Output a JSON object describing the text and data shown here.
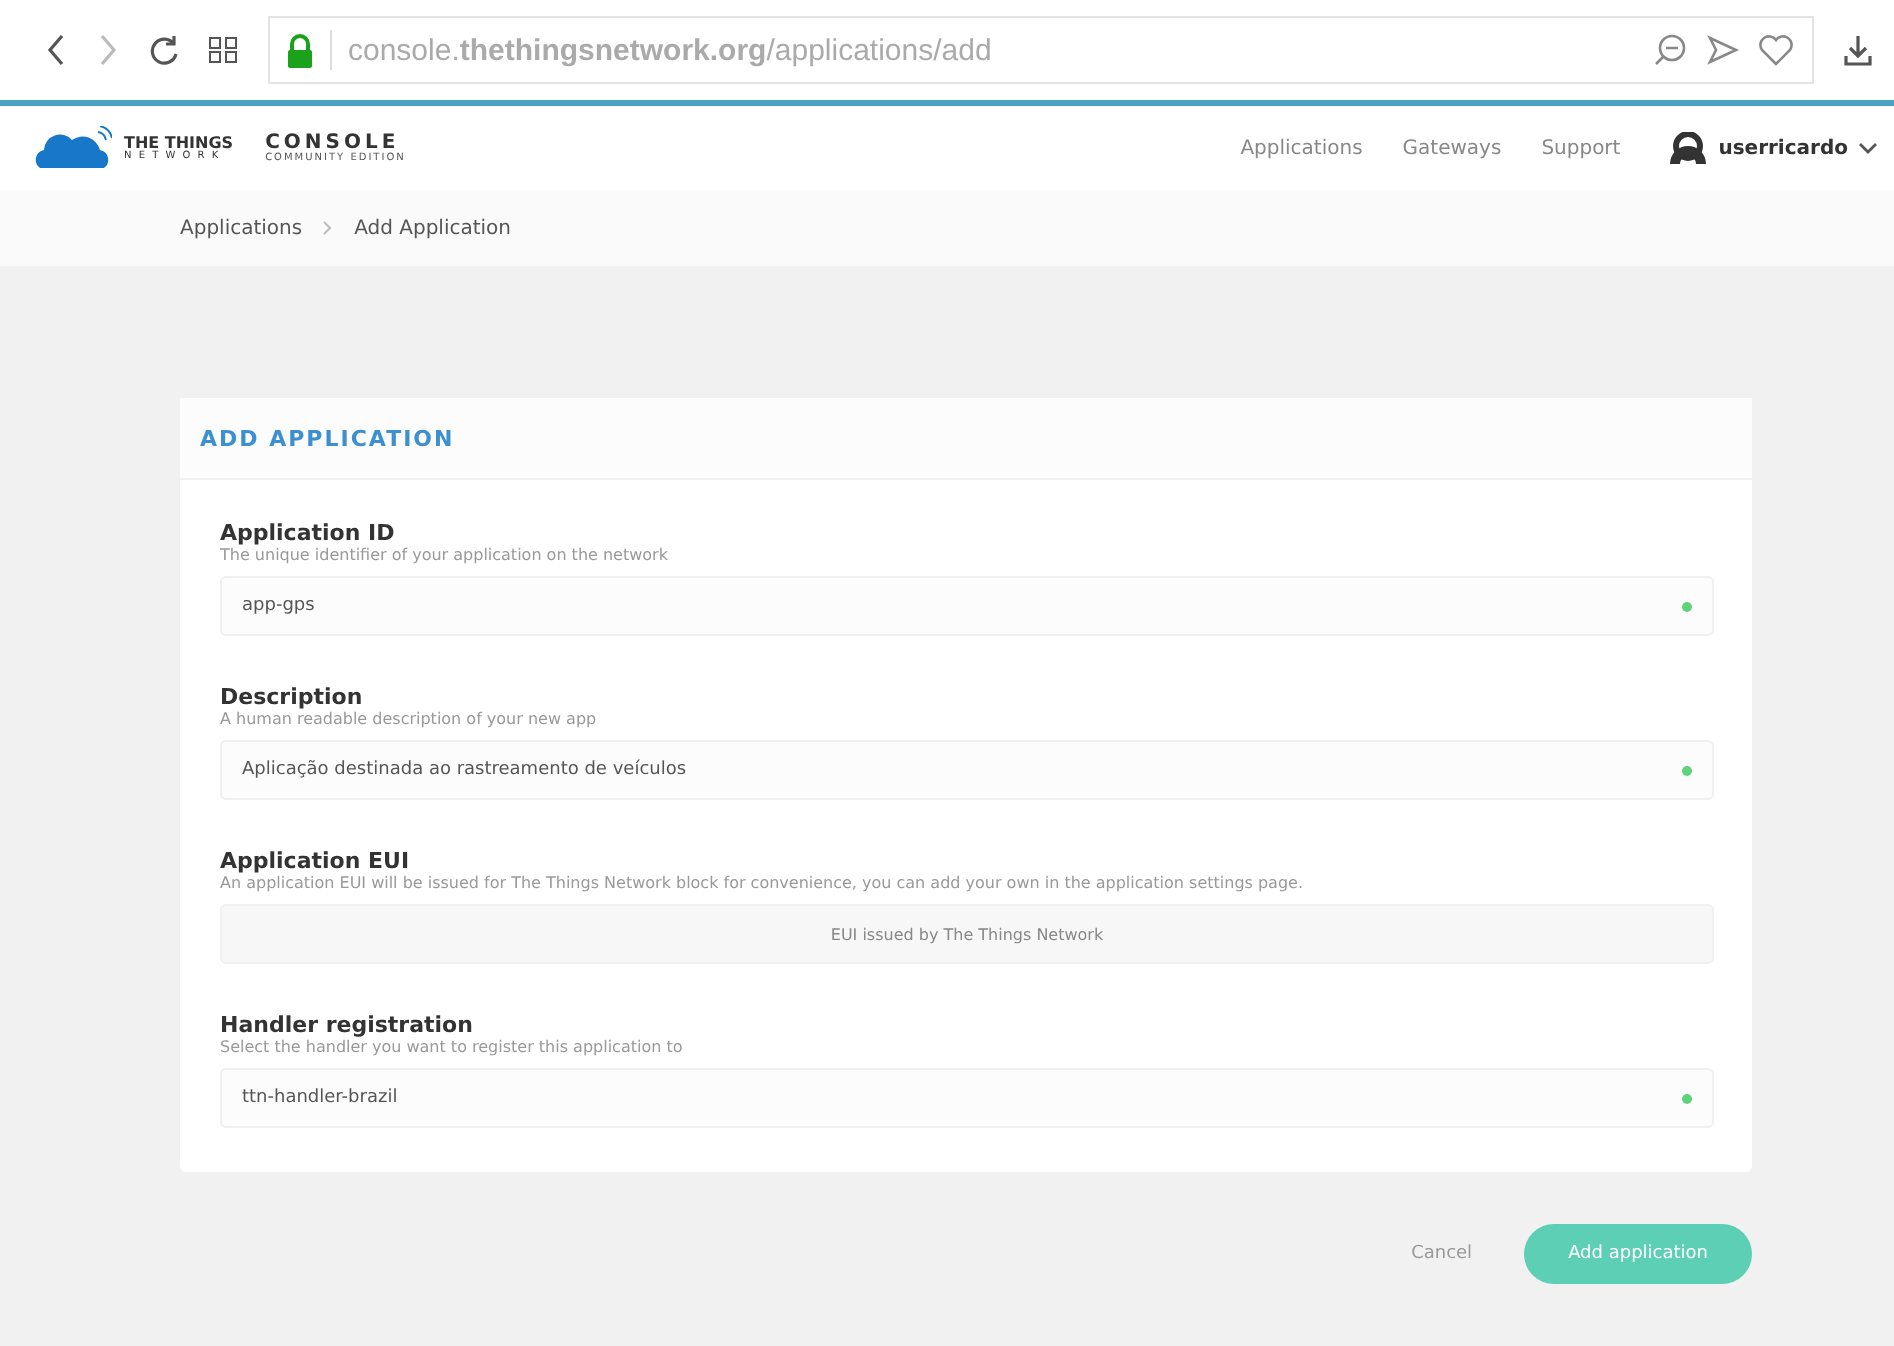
{
  "browser": {
    "url": "console.**thethingsnetwork.org**/applications/add",
    "secure": true
  },
  "header": {
    "logo": {
      "line1": "THE THINGS",
      "line2": "N E T W O R K",
      "product": "CONSOLE",
      "edition": "COMMUNITY EDITION"
    },
    "nav": [
      "Applications",
      "Gateways",
      "Support"
    ],
    "user": "userricardo"
  },
  "breadcrumb": [
    "Applications",
    "Add Application"
  ],
  "card": {
    "title": "ADD APPLICATION",
    "fields": [
      {
        "kind": "input",
        "label": "Application ID",
        "hint": "The unique identifier of your application on the network",
        "value": "app-gps",
        "valid": true
      },
      {
        "kind": "input",
        "label": "Description",
        "hint": "A human readable description of your new app",
        "value": "Aplicação destinada ao rastreamento de veículos",
        "valid": true
      },
      {
        "kind": "readonly",
        "label": "Application EUI",
        "hint": "An application EUI will be issued for The Things Network block for convenience, you can add your own in the application settings page.",
        "placeholder": "EUI issued by The Things Network"
      },
      {
        "kind": "input",
        "label": "Handler registration",
        "hint": "Select the handler you want to register this application to",
        "value": "ttn-handler-brazil",
        "valid": true
      }
    ]
  },
  "actions": {
    "cancel": "Cancel",
    "submit": "Add application"
  }
}
